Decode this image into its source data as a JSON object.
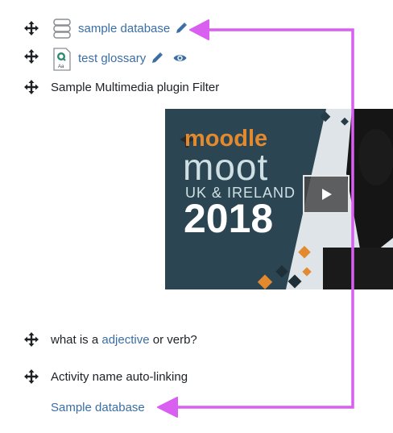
{
  "items": {
    "database": {
      "label": "sample database"
    },
    "glossary": {
      "label": "test glossary"
    },
    "filter": {
      "label": "Sample Multimedia plugin Filter"
    },
    "question": {
      "before": "what is a ",
      "link": "adjective",
      "after": " or verb?"
    },
    "autolink": {
      "label": "Activity name auto-linking",
      "link": "Sample database"
    }
  },
  "video": {
    "brand_prefix": "m",
    "brand_rest": "oodle",
    "title": "moot",
    "region": "UK & IRELAND",
    "year": "2018"
  },
  "icons": {
    "move": "move-arrows-icon",
    "database": "database-icon",
    "glossary": "glossary-icon",
    "edit": "pencil-icon",
    "visibility": "eye-icon",
    "play": "play-icon"
  },
  "colors": {
    "link": "#3a6ea5",
    "annotation_arrow": "#d95ff0",
    "video_bg": "#2b4652",
    "accent_orange": "#e38a2f"
  }
}
